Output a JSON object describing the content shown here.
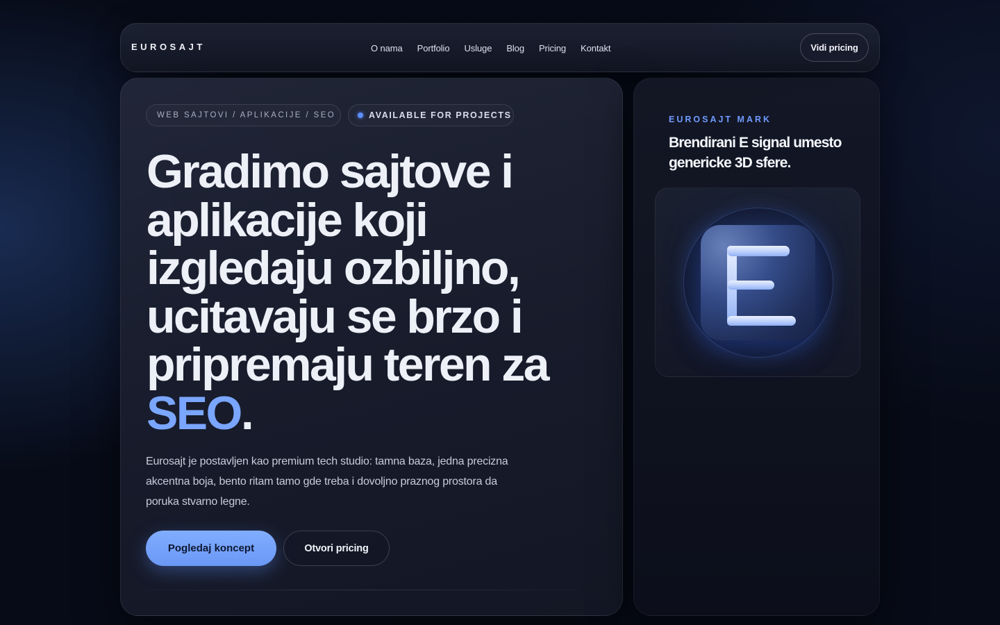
{
  "nav": {
    "brand": "EUROSAJT",
    "links": [
      "O nama",
      "Portfolio",
      "Usluge",
      "Blog",
      "Pricing",
      "Kontakt"
    ],
    "cta": "Vidi pricing"
  },
  "hero": {
    "tag_pill": "WEB SAJTOVI / APLIKACIJE / SEO",
    "status_pill": "AVAILABLE FOR PROJECTS",
    "headline_lines": [
      "Gradimo sajtove i",
      "aplikacije koji",
      "izgledaju ozbiljno,",
      "ucitavaju se brzo i",
      "pripremaju teren za"
    ],
    "headline_accent": "SEO",
    "headline_end": ".",
    "lead": "Eurosajt je postavljen kao premium tech studio: tamna baza, jedna precizna akcentna boja, bento ritam tamo gde treba i dovoljno praznog prostora da poruka stvarno legne.",
    "primary_button": "Pogledaj koncept",
    "secondary_button": "Otvori pricing"
  },
  "side": {
    "eyebrow": "EUROSAJT MARK",
    "title": "Brendirani E signal umesto genericke 3D sfere."
  },
  "colors": {
    "accent": "#7aa6ff",
    "background": "#070b17",
    "card": "#1e2335",
    "primary_button": "#76a2fb"
  },
  "icons": {
    "status_dot": "status-dot-icon",
    "brand_mark": "e-letter-mark-icon"
  }
}
